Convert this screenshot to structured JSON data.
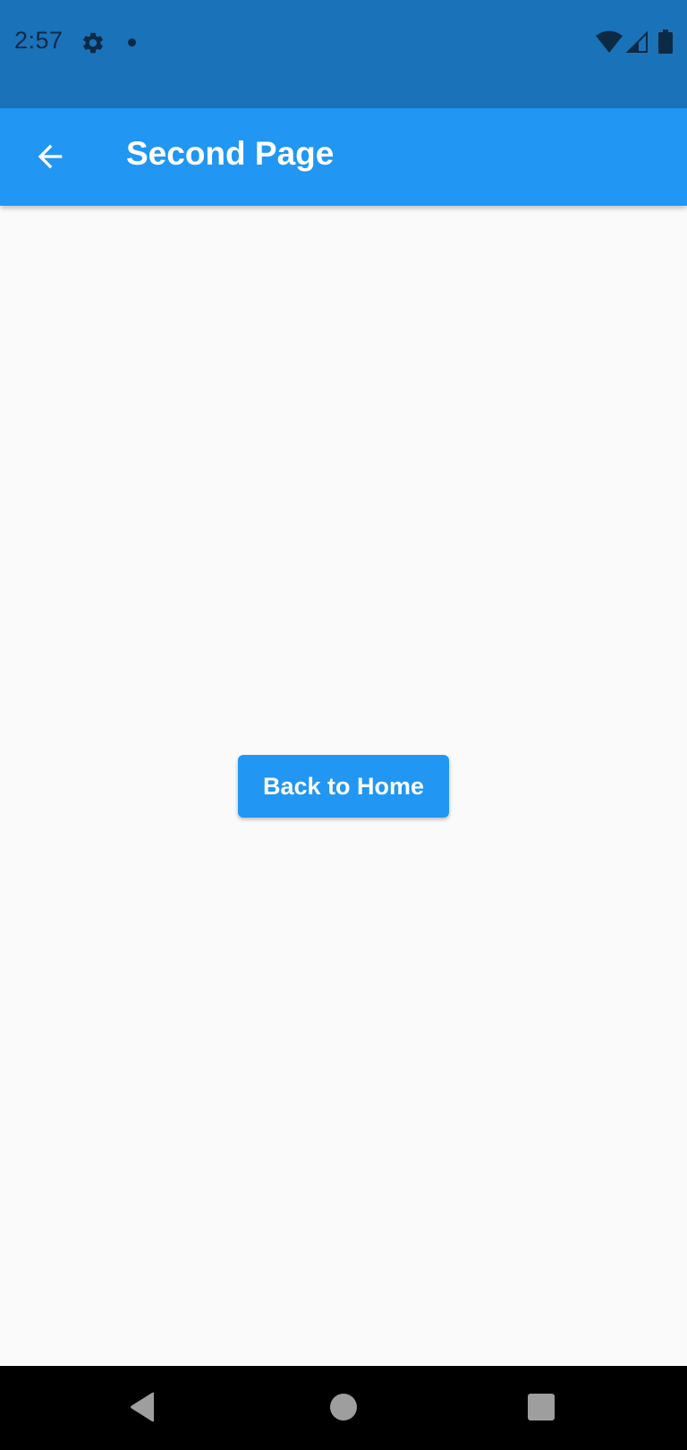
{
  "status_bar": {
    "time": "2:57",
    "icons": [
      "settings-icon",
      "notification-dot",
      "wifi-icon",
      "cell-signal-icon",
      "battery-icon"
    ],
    "background_color": "#1a72b9"
  },
  "app_bar": {
    "title": "Second Page",
    "back_icon": "arrow-back-icon",
    "background_color": "#2196f3"
  },
  "main": {
    "button_label": "Back to Home",
    "button_color": "#2196f3",
    "background_color": "#fafafa"
  },
  "nav_bar": {
    "buttons": [
      "back-triangle-icon",
      "home-circle-icon",
      "recents-square-icon"
    ],
    "background_color": "#000000"
  }
}
